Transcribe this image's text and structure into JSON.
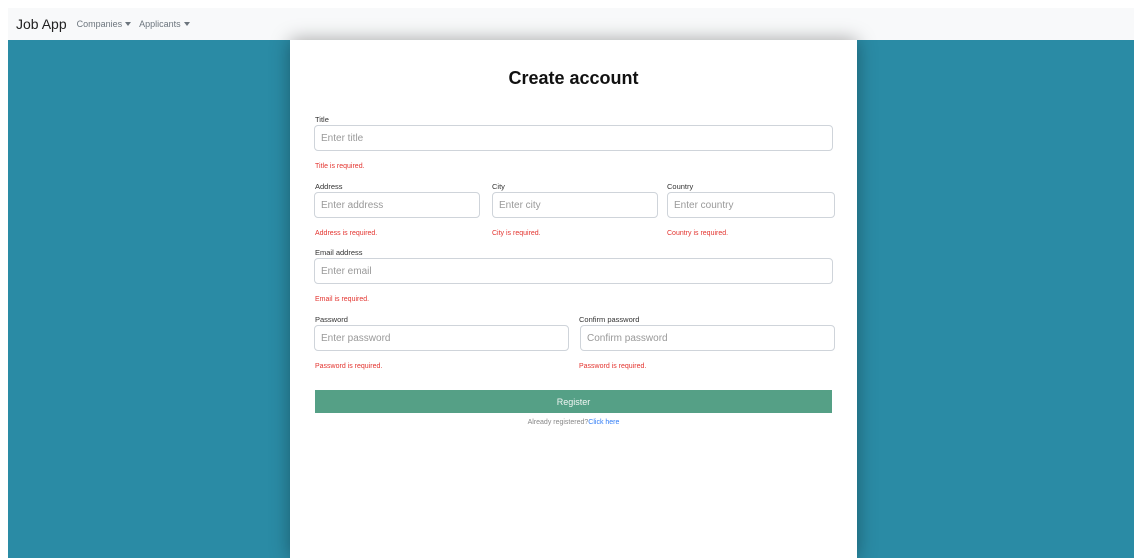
{
  "navbar": {
    "brand": "Job App",
    "items": [
      {
        "label": "Companies"
      },
      {
        "label": "Applicants"
      }
    ]
  },
  "form": {
    "title": "Create account",
    "title_field": {
      "label": "Title",
      "placeholder": "Enter title",
      "error": "Title is required."
    },
    "address_field": {
      "label": "Address",
      "placeholder": "Enter address",
      "error": "Address is required."
    },
    "city_field": {
      "label": "City",
      "placeholder": "Enter city",
      "error": "City is required."
    },
    "country_field": {
      "label": "Country",
      "placeholder": "Enter country",
      "error": "Country is required."
    },
    "email_field": {
      "label": "Email address",
      "placeholder": "Enter email",
      "error": "Email is required."
    },
    "password_field": {
      "label": "Password",
      "placeholder": "Enter password",
      "error": "Password is required."
    },
    "confirm_password_field": {
      "label": "Confirm password",
      "placeholder": "Confirm password",
      "error": "Password is required."
    },
    "register_button": "Register",
    "footer_text": "Already registered?",
    "footer_link": "Click here"
  },
  "colors": {
    "background": "#2a8ba5",
    "button": "#55a086",
    "error": "#e3342f",
    "link": "#2e7bf6"
  }
}
